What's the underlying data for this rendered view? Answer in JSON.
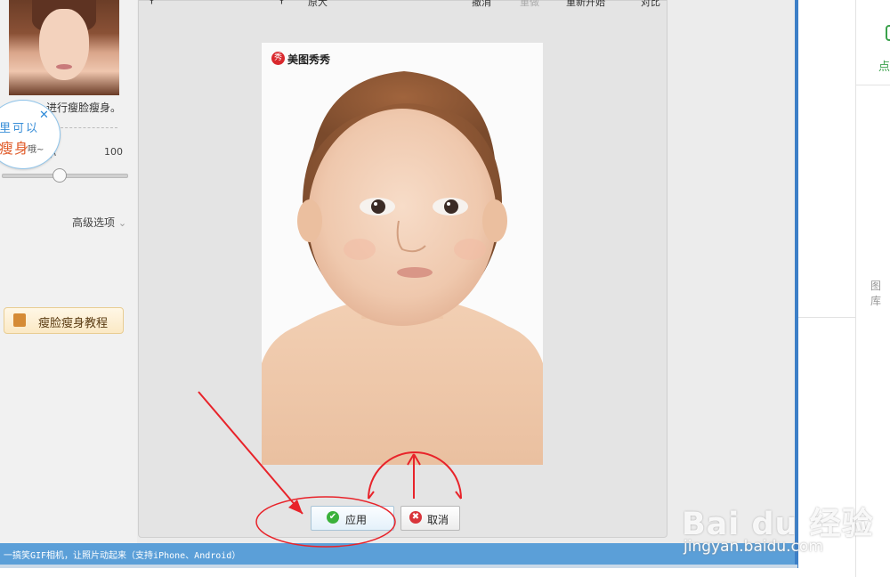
{
  "left": {
    "description": "进行瘦脸瘦身。",
    "size_label": "小",
    "size_value": "100",
    "slider_level_percent": 45,
    "advanced_label": "高级选项",
    "tutorial_button": "瘦脸瘦身教程",
    "bubble_line1": "里可以",
    "bubble_line2": "瘦身",
    "bubble_line3": "哦~",
    "bubble_close": "✕"
  },
  "center": {
    "toolbar": [
      {
        "label": "原大",
        "icon": "one-to-one-icon"
      },
      {
        "label": "撤消",
        "icon": "undo-icon"
      },
      {
        "label": "重做",
        "icon": "redo-icon"
      },
      {
        "label": "重新开始",
        "icon": "restart-icon"
      },
      {
        "label": "对比",
        "icon": "compare-icon"
      }
    ],
    "watermark_logo": "秀",
    "watermark_text": "美图秀秀",
    "apply_label": "应用",
    "cancel_label": "取消",
    "apply_icon": "✔",
    "cancel_icon": "✖"
  },
  "right": {
    "green_text": "点",
    "gray_text": "图库"
  },
  "bottom_bar": {
    "text": "一搞笑GIF相机，让照片动起来（支持iPhone、Android）"
  },
  "watermark": {
    "brand": "Bai du 经验",
    "url": "jingyan.baidu.com"
  },
  "colors": {
    "accent_blue": "#5b9fd8",
    "annotation_red": "#e8232a",
    "apply_green": "#3bb13b",
    "cancel_red": "#d9343a"
  }
}
